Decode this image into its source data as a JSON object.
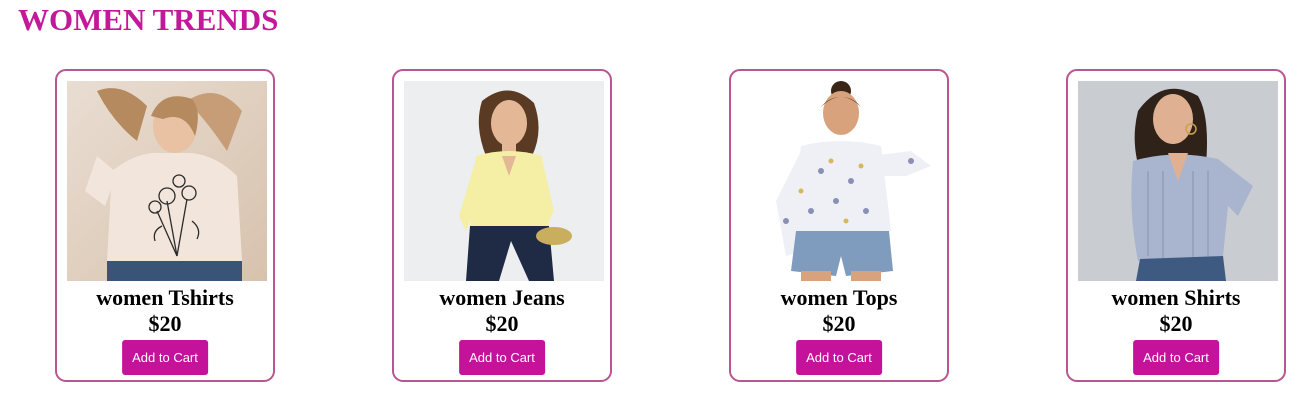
{
  "page": {
    "title": "WOMEN TRENDS",
    "accent_color": "#c4189a"
  },
  "products": [
    {
      "name": "women Tshirts",
      "price": "$20",
      "button_label": "Add to Cart",
      "image_alt": "women-tshirt-photo"
    },
    {
      "name": "women Jeans",
      "price": "$20",
      "button_label": "Add to Cart",
      "image_alt": "women-jeans-photo"
    },
    {
      "name": "women Tops",
      "price": "$20",
      "button_label": "Add to Cart",
      "image_alt": "women-tops-photo"
    },
    {
      "name": "women Shirts",
      "price": "$20",
      "button_label": "Add to Cart",
      "image_alt": "women-shirts-photo"
    }
  ]
}
